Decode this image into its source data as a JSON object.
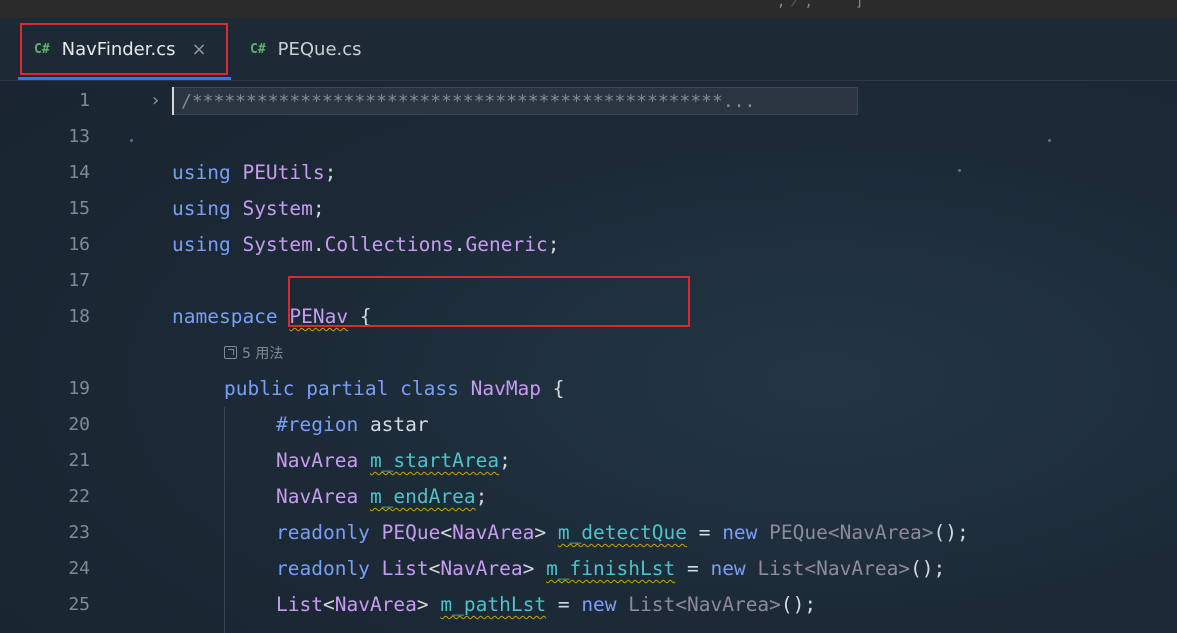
{
  "tabs": [
    {
      "lang": "C#",
      "label": "NavFinder.cs",
      "close": "×",
      "active": true
    },
    {
      "lang": "C#",
      "label": "PEQue.cs",
      "active": false
    }
  ],
  "top_glyph": "‛ ‚ ⁄ ‚ ‛ ′ ]",
  "editor": {
    "line_numbers": [
      "1",
      "13",
      "14",
      "15",
      "16",
      "17",
      "18",
      "19",
      "20",
      "21",
      "22",
      "23",
      "24",
      "25"
    ],
    "fold_arrow": "›",
    "folded_text": "/*************************************************...",
    "inlay_hint": "5 用法",
    "lines": {
      "l14": {
        "kw": "using",
        "ns": "PEUtils",
        "end": ";"
      },
      "l15": {
        "kw": "using",
        "ns": "System",
        "end": ";"
      },
      "l16": {
        "kw": "using",
        "ns1": "System",
        "dot1": ".",
        "ns2": "Collections",
        "dot2": ".",
        "ns3": "Generic",
        "end": ";"
      },
      "l18": {
        "kw": "namespace",
        "ns": "PENav",
        "end": " {"
      },
      "l19": {
        "kw1": "public",
        "kw2": "partial",
        "kw3": "class",
        "type": "NavMap",
        "end": " {"
      },
      "l20": {
        "dir": "#region",
        "name": "astar"
      },
      "l21": {
        "type": "NavArea",
        "field": "m_startArea",
        "end": ";"
      },
      "l22": {
        "type": "NavArea",
        "field": "m_endArea",
        "end": ";"
      },
      "l23": {
        "kw": "readonly",
        "type1": "PEQue",
        "lt": "<",
        "type2": "NavArea",
        "gt": ">",
        "field": "m_detectQue",
        "eq": " = ",
        "new": "new",
        "rtype": "PEQue<NavArea>",
        "end": "();"
      },
      "l24": {
        "kw": "readonly",
        "type1": "List",
        "lt": "<",
        "type2": "NavArea",
        "gt": ">",
        "field": "m_finishLst",
        "eq": " = ",
        "new": "new",
        "rtype": "List<NavArea>",
        "end": "();"
      },
      "l25": {
        "type1": "List",
        "lt": "<",
        "type2": "NavArea",
        "gt": ">",
        "field": "m_pathLst",
        "eq": " = ",
        "new": "new",
        "rtype": "List<NavArea>",
        "end": "();"
      }
    }
  },
  "colors": {
    "accent": "#3574f0",
    "highlight_box": "#e0262f",
    "keyword": "#7a9ef5",
    "type": "#c79cf0",
    "field": "#4fc1c9"
  }
}
